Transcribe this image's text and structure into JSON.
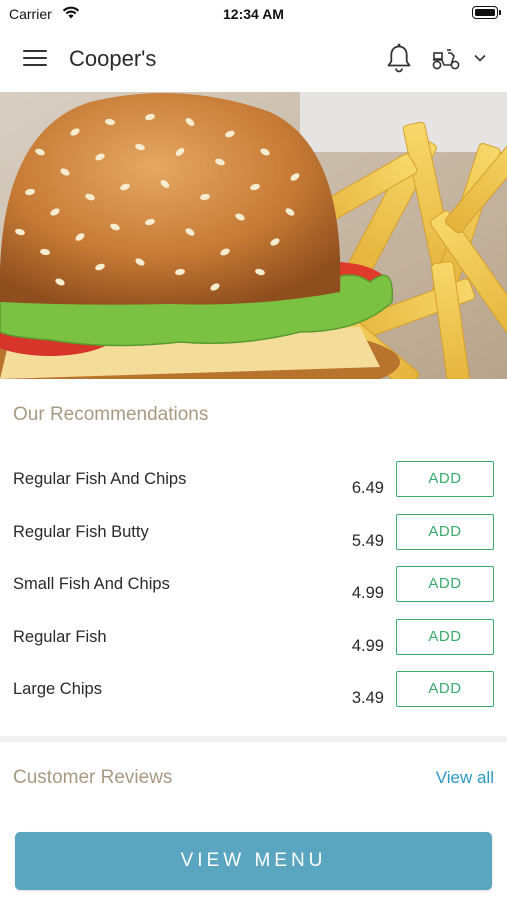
{
  "status_bar": {
    "carrier": "Carrier",
    "time": "12:34 AM"
  },
  "nav": {
    "title": "Cooper's"
  },
  "recommendations": {
    "title": "Our Recommendations",
    "add_label": "ADD",
    "items": [
      {
        "name": "Regular Fish And Chips",
        "price": "6.49"
      },
      {
        "name": "Regular Fish Butty",
        "price": "5.49"
      },
      {
        "name": "Small Fish And Chips",
        "price": "4.99"
      },
      {
        "name": "Regular Fish",
        "price": "4.99"
      },
      {
        "name": "Large Chips",
        "price": "3.49"
      }
    ]
  },
  "reviews": {
    "title": "Customer Reviews",
    "view_all": "View all"
  },
  "cta": {
    "label": "VIEW MENU"
  },
  "colors": {
    "accent_green": "#3aaa6a",
    "link_blue": "#2b98c4",
    "cta_blue": "#5aa6c0",
    "section_title": "#a89a80"
  }
}
